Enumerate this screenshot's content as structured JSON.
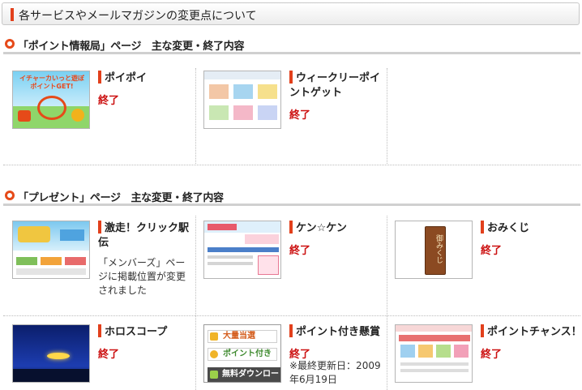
{
  "header": {
    "title": "各サービスやメールマガジンの変更点について"
  },
  "sections": [
    {
      "title": "「ポイント情報局」ページ　主な変更・終了内容",
      "items": [
        {
          "name": "ポイポイ",
          "status": "終了",
          "thumb_icon": "poipoi-thumbnail",
          "thumb_text": "イチャーカいっと遊ぼ  ポイントGET!"
        },
        {
          "name": "ウィークリーポイントゲット",
          "status": "終了",
          "thumb_icon": "weekly-point-thumbnail"
        }
      ]
    },
    {
      "title": "「プレゼント」ページ　主な変更・終了内容",
      "items": [
        {
          "name": "激走！クリック駅伝",
          "note": "「メンバーズ」ページに掲載位置が変更されました",
          "thumb_icon": "click-ekiden-thumbnail"
        },
        {
          "name": "ケン☆ケン",
          "status": "終了",
          "thumb_icon": "kenken-thumbnail"
        },
        {
          "name": "おみくじ",
          "status": "終了",
          "thumb_icon": "omikuji-thumbnail",
          "thumb_text": "御みくじ"
        },
        {
          "name": "ホロスコープ",
          "status": "終了",
          "thumb_icon": "horoscope-thumbnail"
        },
        {
          "name": "ポイント付き懸賞",
          "status": "終了",
          "note": "※最終更新日：2009年6月19日",
          "thumb_icon": "point-kenshou-thumbnail",
          "thumb_lines": [
            "大量当選",
            "ポイント付き",
            "無料ダウンロー"
          ]
        },
        {
          "name": "ポイントチャンス！",
          "status": "終了",
          "thumb_icon": "point-chance-thumbnail"
        }
      ]
    }
  ],
  "colors": {
    "accent": "#e2401c",
    "status": "#cc1111",
    "ring": "#e64a19"
  }
}
